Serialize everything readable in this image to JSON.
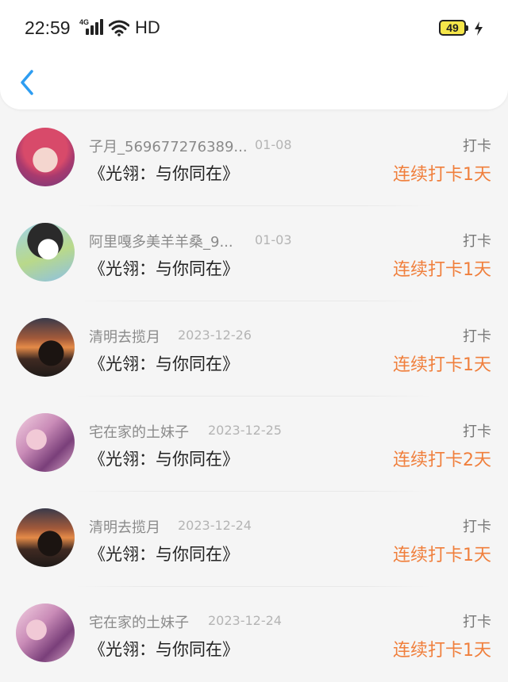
{
  "status_bar": {
    "time": "22:59",
    "network": "4G",
    "hd": "HD",
    "battery": "49"
  },
  "colors": {
    "accent_blue": "#2e9df1",
    "streak_orange": "#f07f3c"
  },
  "rows": [
    {
      "username": "子月_569677276389...",
      "date": "01-08",
      "book": "《光翎：与你同在》",
      "action": "打卡",
      "streak": "连续打卡1天"
    },
    {
      "username": "阿里嘎多美羊羊桑_9...",
      "date": "01-03",
      "book": "《光翎：与你同在》",
      "action": "打卡",
      "streak": "连续打卡1天"
    },
    {
      "username": "清明去揽月",
      "date": "2023-12-26",
      "book": "《光翎：与你同在》",
      "action": "打卡",
      "streak": "连续打卡1天"
    },
    {
      "username": "宅在家的土妹子",
      "date": "2023-12-25",
      "book": "《光翎：与你同在》",
      "action": "打卡",
      "streak": "连续打卡2天"
    },
    {
      "username": "清明去揽月",
      "date": "2023-12-24",
      "book": "《光翎：与你同在》",
      "action": "打卡",
      "streak": "连续打卡1天"
    },
    {
      "username": "宅在家的土妹子",
      "date": "2023-12-24",
      "book": "《光翎：与你同在》",
      "action": "打卡",
      "streak": "连续打卡1天"
    }
  ]
}
